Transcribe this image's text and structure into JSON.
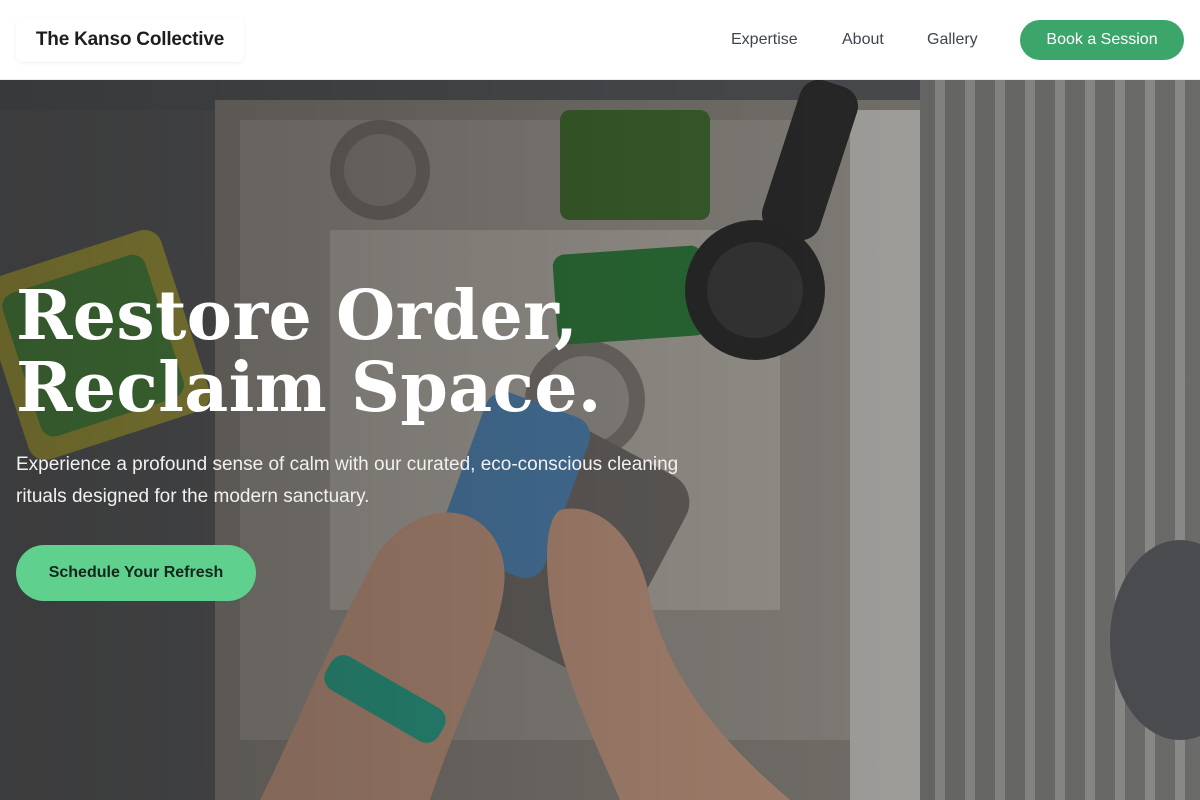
{
  "header": {
    "brand": "The Kanso Collective",
    "nav": [
      "Expertise",
      "About",
      "Gallery"
    ],
    "cta_label": "Book a Session"
  },
  "hero": {
    "headline_line1": "Restore Order,",
    "headline_line2": "Reclaim Space.",
    "subtext": "Experience a profound sense of calm with our curated, eco-conscious cleaning rituals designed for the modern sanctuary.",
    "cta_label": "Schedule Your Refresh",
    "image_description_icon": "kitchen-sink-photo"
  },
  "colors": {
    "accent": "#3ba56a",
    "cta": "#5fd08e"
  }
}
